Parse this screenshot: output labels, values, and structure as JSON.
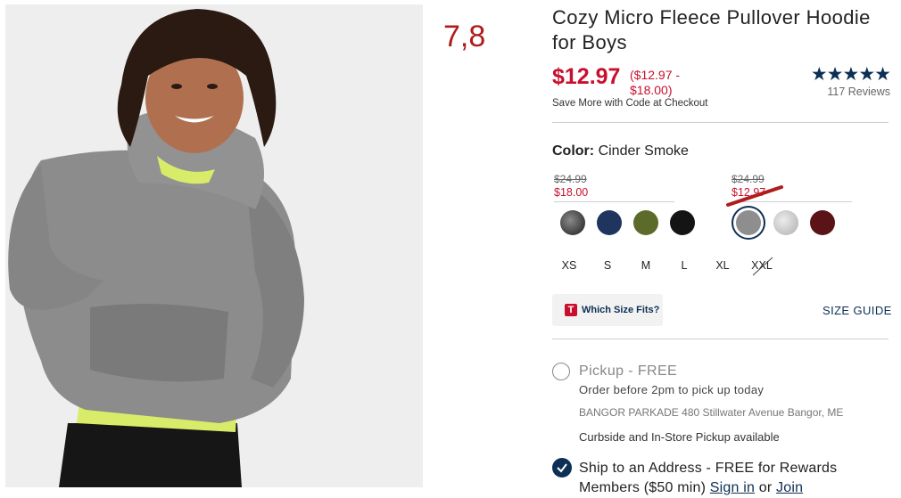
{
  "annotation": "7,8",
  "product": {
    "title": "Cozy Micro Fleece Pullover Hoodie for Boys",
    "price": "$12.97",
    "price_range": "($12.97 - $18.00)",
    "save_note": "Save More with Code at Checkout",
    "rating": {
      "stars": "★★★★★",
      "reviews": "117 Reviews",
      "value": 5
    }
  },
  "color": {
    "label": "Color:",
    "value": "Cinder Smoke"
  },
  "price_groups": [
    {
      "was": "$24.99",
      "now": "$18.00"
    },
    {
      "was": "$24.99",
      "now": "$12.97"
    }
  ],
  "swatches": [
    {
      "name": "charcoal-camo",
      "color": "#4a4a4a"
    },
    {
      "name": "navy",
      "color": "#1f3560"
    },
    {
      "name": "olive",
      "color": "#5c6a2a"
    },
    {
      "name": "black",
      "color": "#141414"
    },
    {
      "name": "cinder-smoke",
      "color": "#8e8e8e",
      "selected": true
    },
    {
      "name": "light-heather",
      "color": "#cfcfcf"
    },
    {
      "name": "burgundy",
      "color": "#5a1418"
    }
  ],
  "sizes": [
    "XS",
    "S",
    "M",
    "L",
    "XL",
    "XXL"
  ],
  "size_help": {
    "badge": "T",
    "label": "Which Size Fits?",
    "guide": "SIZE GUIDE"
  },
  "fulfillment": {
    "pickup_title": "Pickup - FREE",
    "pickup_sub": "Order before 2pm to pick up today",
    "store_name": "BANGOR PARKADE",
    "store_address": "480 Stillwater Avenue",
    "store_city": "Bangor, ME",
    "curbside": "Curbside and In-Store Pickup available",
    "ship_text": "Ship to an Address - FREE for Rewards Members ($50 min)",
    "ship_link_1": "Sign in",
    "ship_link_sep": "or",
    "ship_link_2": "Join"
  },
  "colors": {
    "sale_red": "#c8102e",
    "navy": "#0d2f55",
    "annotation_red": "#b01c1c"
  }
}
